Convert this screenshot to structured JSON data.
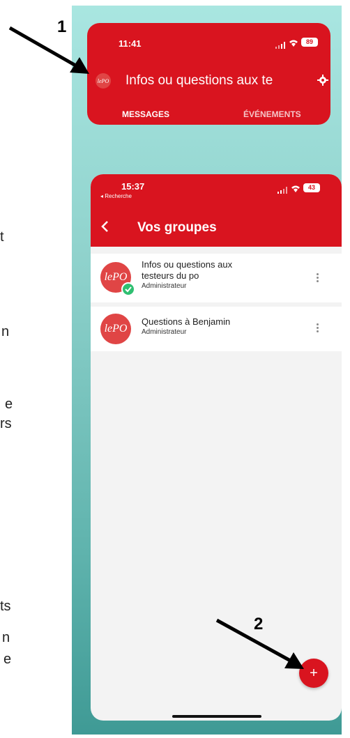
{
  "annotations": {
    "label_1": "1",
    "label_2": "2"
  },
  "left_fragments": [
    {
      "text": "t"
    },
    {
      "text": "n"
    },
    {
      "text": "e"
    },
    {
      "text": "rs"
    },
    {
      "text": "ts"
    },
    {
      "text": "n"
    },
    {
      "text": "e"
    }
  ],
  "screen1": {
    "time": "11:41",
    "battery": "89",
    "group_title": "Infos ou questions aux te",
    "tab_messages": "MESSAGES",
    "tab_events": "ÉVÉNEMENTS",
    "avatar_text": "lePO"
  },
  "screen2": {
    "time": "15:37",
    "back_app": "◂ Recherche",
    "battery": "43",
    "title": "Vos groupes",
    "groups": [
      {
        "name_line1": "Infos ou questions aux",
        "name_line2": "testeurs du po",
        "role": "Administrateur",
        "avatar_text": "lePO"
      },
      {
        "name_line1": "Questions à Benjamin",
        "name_line2": "",
        "role": "Administrateur",
        "avatar_text": "lePO"
      }
    ],
    "fab_symbol": "+"
  },
  "colors": {
    "brand_red": "#d9141f",
    "check_green": "#2fbf71"
  }
}
